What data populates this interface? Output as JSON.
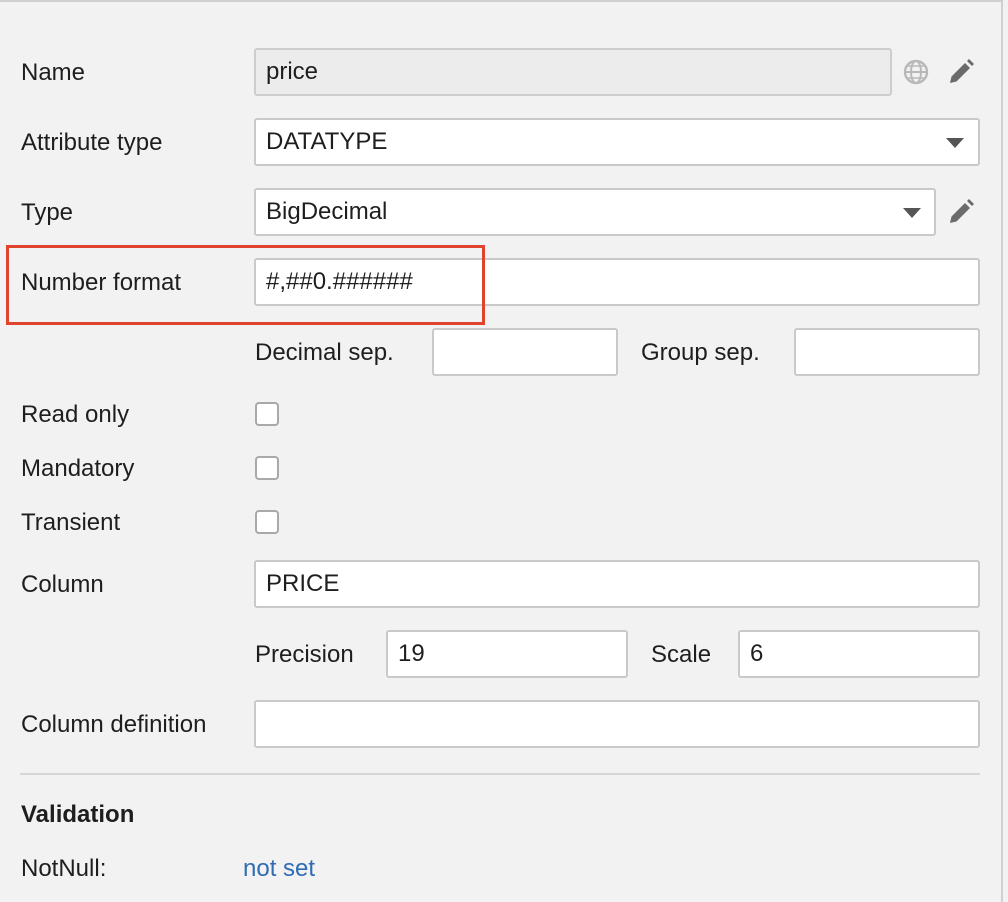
{
  "form": {
    "name": {
      "label": "Name",
      "value": "price"
    },
    "attribute_type": {
      "label": "Attribute type",
      "value": "DATATYPE"
    },
    "type": {
      "label": "Type",
      "value": "BigDecimal"
    },
    "number_format": {
      "label": "Number format",
      "value": "#,##0.######"
    },
    "decimal_sep": {
      "label": "Decimal sep.",
      "value": ""
    },
    "group_sep": {
      "label": "Group sep.",
      "value": ""
    },
    "read_only": {
      "label": "Read only",
      "checked": false
    },
    "mandatory": {
      "label": "Mandatory",
      "checked": false
    },
    "transient": {
      "label": "Transient",
      "checked": false
    },
    "column": {
      "label": "Column",
      "value": "PRICE"
    },
    "precision": {
      "label": "Precision",
      "value": "19"
    },
    "scale": {
      "label": "Scale",
      "value": "6"
    },
    "column_definition": {
      "label": "Column definition",
      "value": ""
    }
  },
  "validation": {
    "title": "Validation",
    "notnull_label": "NotNull:",
    "notnull_value": "not set"
  },
  "icons": {
    "name_localize": "globe-icon",
    "name_edit": "pencil-icon",
    "type_edit": "pencil-icon",
    "dropdown": "chevron-down-icon"
  },
  "colors": {
    "highlight": "#e0442f",
    "link": "#2f6cb3"
  }
}
